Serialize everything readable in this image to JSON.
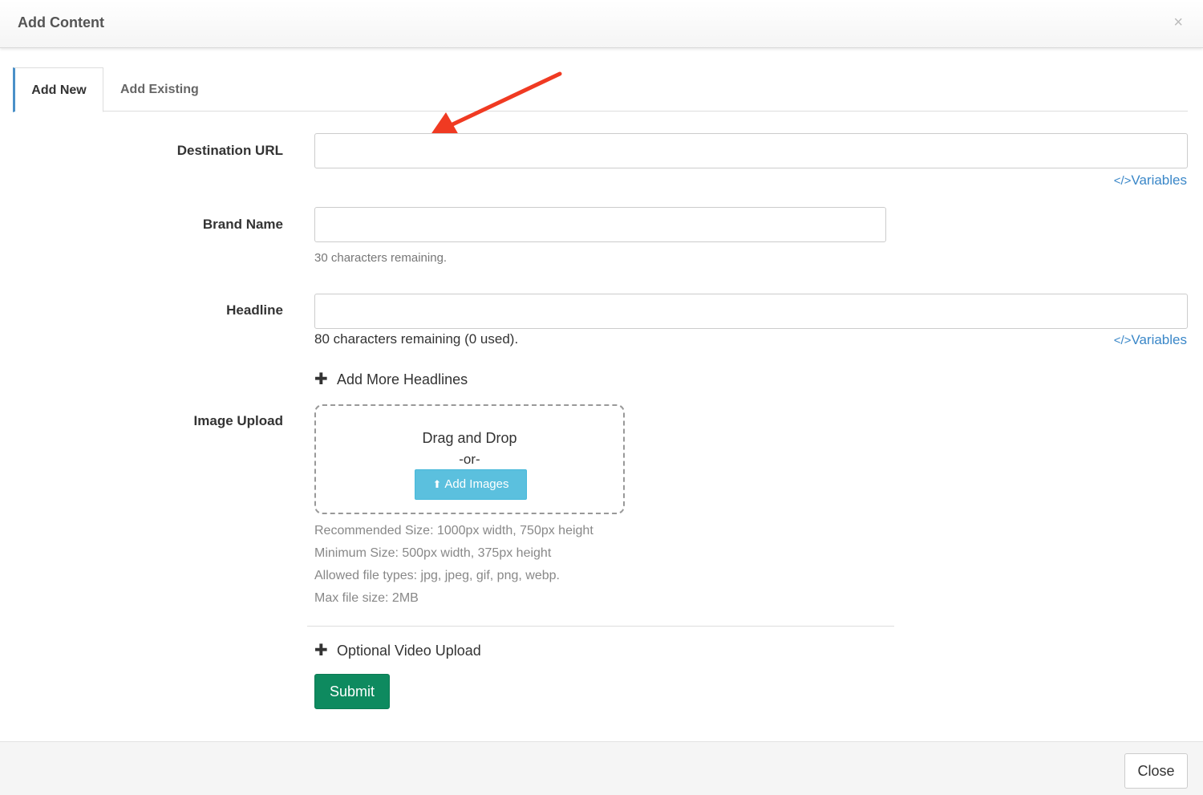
{
  "modal": {
    "title": "Add Content",
    "close_icon": "×"
  },
  "tabs": [
    {
      "label": "Add New",
      "active": true
    },
    {
      "label": "Add Existing",
      "active": false
    }
  ],
  "form": {
    "destination_url": {
      "label": "Destination URL",
      "value": "",
      "variables_link": "Variables",
      "variables_icon": "</>"
    },
    "brand_name": {
      "label": "Brand Name",
      "value": "",
      "helper": "30 characters remaining."
    },
    "headline": {
      "label": "Headline",
      "value": "",
      "helper": "80 characters remaining (0 used).",
      "variables_link": "Variables",
      "variables_icon": "</>"
    },
    "add_more_headlines": {
      "icon": "plus-icon",
      "label": "Add More Headlines"
    },
    "image_upload": {
      "label": "Image Upload",
      "drag_text": "Drag and Drop",
      "or_text": "-or-",
      "button_label": "Add Images",
      "button_icon": "upload-icon",
      "specs": [
        "Recommended Size: 1000px width, 750px height",
        "Minimum Size: 500px width, 375px height",
        "Allowed file types: jpg, jpeg, gif, png, webp.",
        "Max file size: 2MB"
      ]
    },
    "optional_video": {
      "icon": "plus-icon",
      "label": "Optional Video Upload"
    },
    "submit_label": "Submit"
  },
  "footer": {
    "close_label": "Close"
  },
  "colors": {
    "accent_tab": "#4a90c8",
    "link": "#3a87c8",
    "info_button": "#5bc0de",
    "submit_button": "#0e8a5f",
    "annotation_arrow": "#f03a22"
  }
}
